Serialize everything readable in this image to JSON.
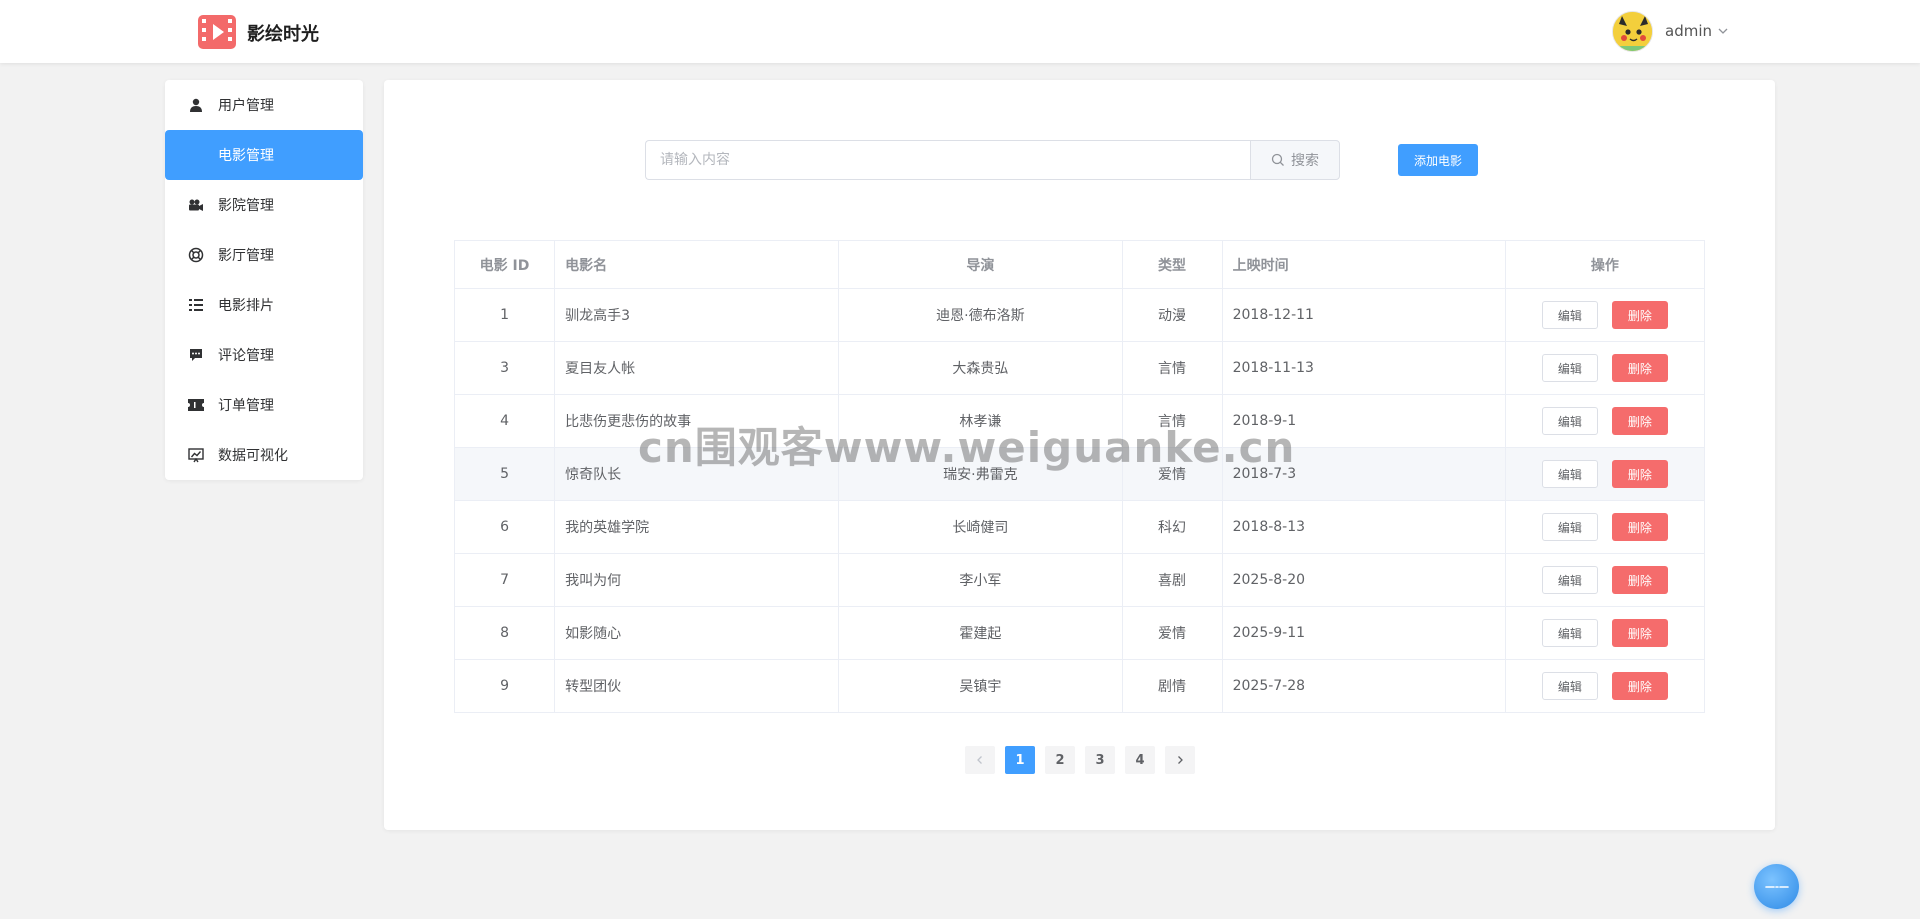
{
  "app": {
    "brand": "影绘时光"
  },
  "user": {
    "name": "admin"
  },
  "sidebar": {
    "items": [
      {
        "label": "用户管理",
        "icon": "user-icon",
        "active": false
      },
      {
        "label": "电影管理",
        "icon": "film-icon",
        "active": true
      },
      {
        "label": "影院管理",
        "icon": "camera-icon",
        "active": false
      },
      {
        "label": "影厅管理",
        "icon": "lifebuoy-icon",
        "active": false
      },
      {
        "label": "电影排片",
        "icon": "list-icon",
        "active": false
      },
      {
        "label": "评论管理",
        "icon": "comment-icon",
        "active": false
      },
      {
        "label": "订单管理",
        "icon": "ticket-icon",
        "active": false
      },
      {
        "label": "数据可视化",
        "icon": "chart-icon",
        "active": false
      }
    ]
  },
  "search": {
    "placeholder": "请输入内容",
    "button_label": "搜索"
  },
  "toolbar": {
    "add_label": "添加电影"
  },
  "table": {
    "columns": [
      "电影 ID",
      "电影名",
      "导演",
      "类型",
      "上映时间",
      "操作"
    ],
    "rows": [
      {
        "id": "1",
        "name": "驯龙高手3",
        "director": "迪恩·德布洛斯",
        "type": "动漫",
        "date": "2018-12-11"
      },
      {
        "id": "3",
        "name": "夏目友人帐",
        "director": "大森贵弘",
        "type": "言情",
        "date": "2018-11-13"
      },
      {
        "id": "4",
        "name": "比悲伤更悲伤的故事",
        "director": "林孝谦",
        "type": "言情",
        "date": "2018-9-1"
      },
      {
        "id": "5",
        "name": "惊奇队长",
        "director": "瑞安·弗雷克",
        "type": "爱情",
        "date": "2018-7-3"
      },
      {
        "id": "6",
        "name": "我的英雄学院",
        "director": "长崎健司",
        "type": "科幻",
        "date": "2018-8-13"
      },
      {
        "id": "7",
        "name": "我叫为何",
        "director": "李小军",
        "type": "喜剧",
        "date": "2025-8-20"
      },
      {
        "id": "8",
        "name": "如影随心",
        "director": "霍建起",
        "type": "爱情",
        "date": "2025-9-11"
      },
      {
        "id": "9",
        "name": "转型团伙",
        "director": "吴镇宇",
        "type": "剧情",
        "date": "2025-7-28"
      }
    ],
    "edit_label": "编辑",
    "delete_label": "删除"
  },
  "pagination": {
    "pages": [
      "1",
      "2",
      "3",
      "4"
    ],
    "current": "1"
  },
  "watermark": "cn围观客www.weiguanke.cn",
  "colors": {
    "primary": "#409eff",
    "danger": "#f56c6c"
  }
}
